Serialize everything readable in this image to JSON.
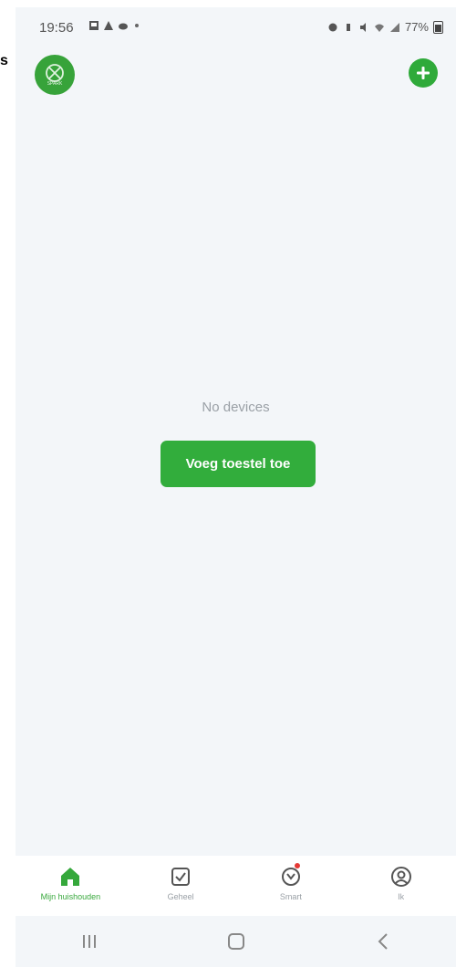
{
  "status_bar": {
    "time": "19:56",
    "battery": "77%"
  },
  "header": {
    "avatar_caption": "SPARK"
  },
  "empty_state": {
    "message": "No devices",
    "button_label": "Voeg toestel toe"
  },
  "bottom_nav": {
    "items": [
      {
        "label": "Mijn huishouden",
        "icon": "home-icon",
        "active": true
      },
      {
        "label": "Geheel",
        "icon": "checkbox-icon",
        "active": false
      },
      {
        "label": "Smart",
        "icon": "smart-icon",
        "active": false
      },
      {
        "label": "Ik",
        "icon": "profile-icon",
        "active": false
      }
    ]
  },
  "colors": {
    "accent": "#32ad3c",
    "background": "#f3f6f9",
    "text_muted": "#9aa0a6"
  }
}
